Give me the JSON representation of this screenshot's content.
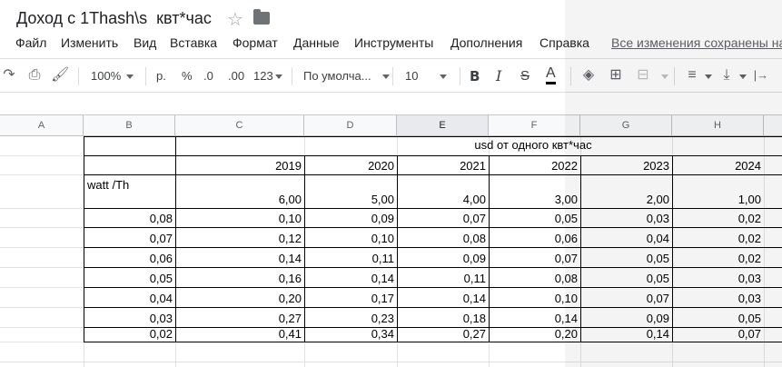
{
  "app": {
    "doc_title": "Доход с 1Thash\\s  квт*час",
    "star_glyph": "☆",
    "saved_status": "Все изменения сохранены на"
  },
  "menu": [
    "Файл",
    "Изменить",
    "Вид",
    "Вставка",
    "Формат",
    "Данные",
    "Инструменты",
    "Дополнения",
    "Справка"
  ],
  "toolbar": {
    "undo_icon": "↷",
    "print_icon": "⎙",
    "paint_icon": "🖌",
    "zoom": "100%",
    "currency": "р.",
    "percent": "%",
    "dec_less": ".0",
    "dec_more": ".00",
    "more_formats": "123",
    "font": "По умолча...",
    "font_size": "10",
    "bold": "B",
    "italic": "I",
    "strike": "S",
    "text_color": "A",
    "fill_icon": "◈",
    "borders_icon": "⊞",
    "merge_icon": "⊟",
    "align_icon": "≡",
    "valign_icon": "⤓",
    "wrap_icon": "|→"
  },
  "columns": [
    "A",
    "B",
    "C",
    "D",
    "E",
    "F",
    "G",
    "H"
  ],
  "sheet": {
    "header_label": "usd от одного квт*час",
    "years": [
      "2019",
      "2020",
      "2021",
      "2022",
      "2023",
      "2024"
    ],
    "row_label": "watt /Th",
    "prices": [
      "6,00",
      "5,00",
      "4,00",
      "3,00",
      "2,00",
      "1,00"
    ],
    "rows": [
      {
        "watt": "0,08",
        "vals": [
          "0,10",
          "0,09",
          "0,07",
          "0,05",
          "0,03",
          "0,02"
        ]
      },
      {
        "watt": "0,07",
        "vals": [
          "0,12",
          "0,10",
          "0,08",
          "0,06",
          "0,04",
          "0,02"
        ]
      },
      {
        "watt": "0,06",
        "vals": [
          "0,14",
          "0,11",
          "0,09",
          "0,07",
          "0,05",
          "0,02"
        ]
      },
      {
        "watt": "0,05",
        "vals": [
          "0,16",
          "0,14",
          "0,11",
          "0,08",
          "0,05",
          "0,03"
        ]
      },
      {
        "watt": "0,04",
        "vals": [
          "0,20",
          "0,17",
          "0,14",
          "0,10",
          "0,07",
          "0,03"
        ]
      },
      {
        "watt": "0,03",
        "vals": [
          "0,27",
          "0,23",
          "0,18",
          "0,14",
          "0,09",
          "0,05"
        ]
      },
      {
        "watt": "0,02",
        "vals": [
          "0,41",
          "0,34",
          "0,27",
          "0,20",
          "0,14",
          "0,07"
        ]
      }
    ]
  }
}
